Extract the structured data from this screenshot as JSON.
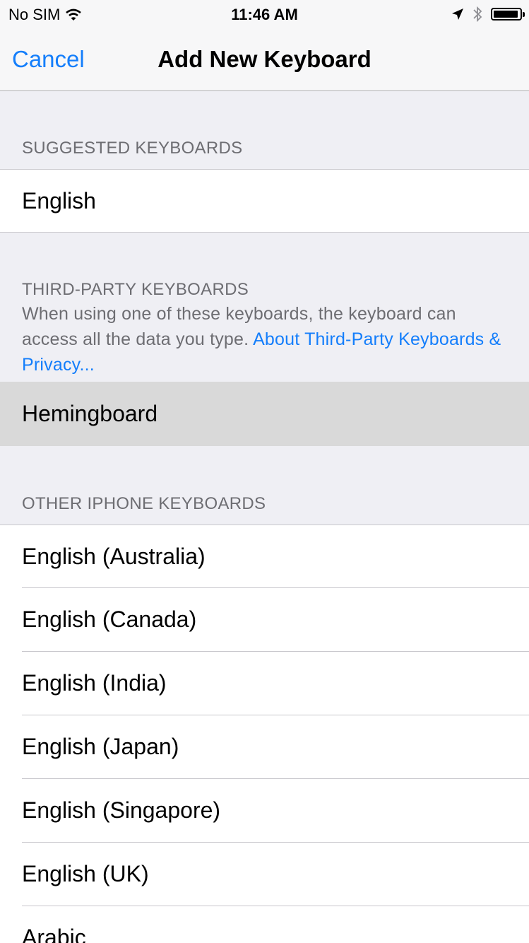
{
  "status_bar": {
    "carrier": "No SIM",
    "time": "11:46 AM",
    "battery_level": 0.95
  },
  "nav": {
    "cancel_label": "Cancel",
    "title": "Add New Keyboard"
  },
  "suggested": {
    "header": "SUGGESTED KEYBOARDS",
    "items": [
      "English"
    ]
  },
  "third_party": {
    "header": "THIRD-PARTY KEYBOARDS",
    "footer_text": "When using one of these keyboards, the keyboard can access all the data you type.",
    "footer_link": "About Third-Party Keyboards & Privacy...",
    "items": [
      "Hemingboard"
    ]
  },
  "other": {
    "header": "OTHER IPHONE KEYBOARDS",
    "items": [
      "English (Australia)",
      "English (Canada)",
      "English (India)",
      "English (Japan)",
      "English (Singapore)",
      "English (UK)",
      "Arabic"
    ]
  }
}
